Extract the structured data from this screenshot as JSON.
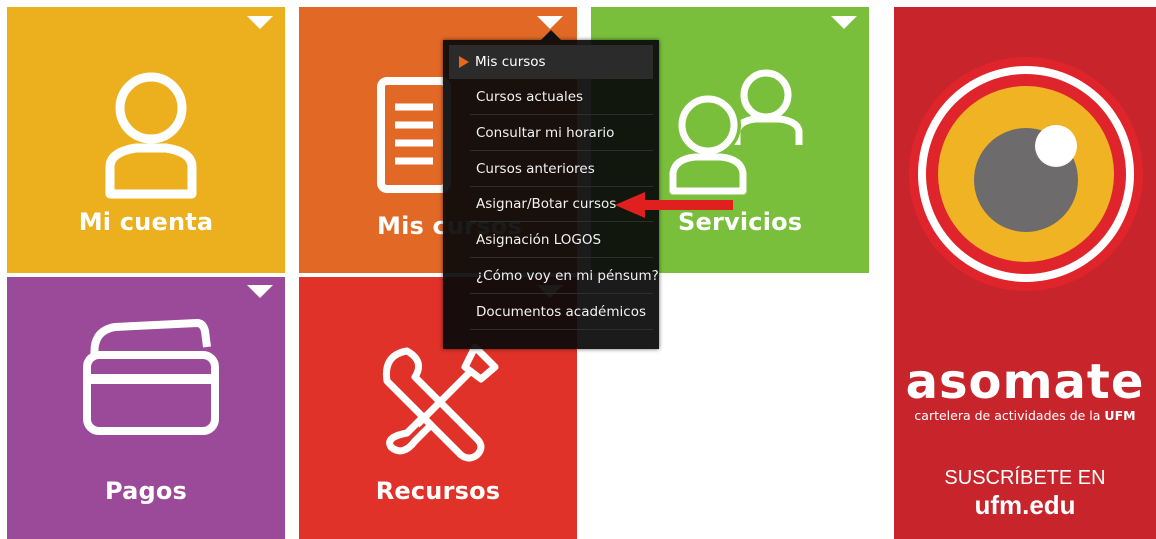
{
  "tiles": {
    "mi_cuenta": {
      "label": "Mi cuenta",
      "color": "#ecb01f",
      "icon": "user-icon"
    },
    "mis_cursos": {
      "label": "Mis cursos",
      "color": "#e16925",
      "icon": "document-icon"
    },
    "servicios": {
      "label": "Servicios",
      "color": "#7abf3b",
      "icon": "users-icon"
    },
    "pagos": {
      "label": "Pagos",
      "color": "#9b4a9a",
      "icon": "credit-card-icon"
    },
    "recursos": {
      "label": "Recursos",
      "color": "#e03229",
      "icon": "tools-icon"
    }
  },
  "dropdown": {
    "header": "Mis cursos",
    "items": [
      "Cursos actuales",
      "Consultar mi horario",
      "Cursos anteriores",
      "Asignar/Botar cursos",
      "Asignación LOGOS",
      "¿Cómo voy en mi pénsum?",
      "Documentos académicos"
    ]
  },
  "banner": {
    "brand": "asomate",
    "subtitle_prefix": "cartelera de actividades de la",
    "subtitle_org": "UFM",
    "cta_prefix": "SUSCRÍBETE EN",
    "cta_domain": "ufm.edu",
    "color": "#c8242b"
  },
  "annotation": {
    "arrow_color": "#e01f1f",
    "icon": "red-arrow-icon"
  }
}
